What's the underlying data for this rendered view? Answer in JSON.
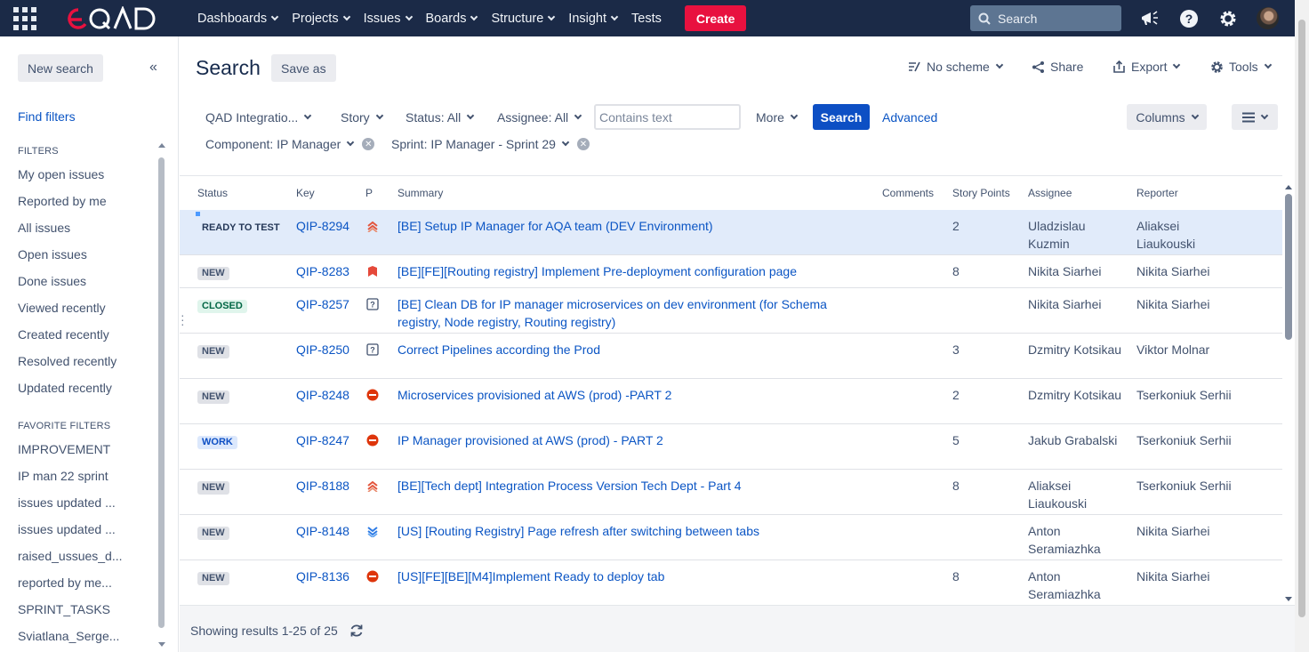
{
  "nav": {
    "items": [
      "Dashboards",
      "Projects",
      "Issues",
      "Boards",
      "Structure",
      "Insight"
    ],
    "tests": "Tests",
    "create": "Create",
    "search_placeholder": "Search"
  },
  "sidebar": {
    "new_search": "New search",
    "find_filters": "Find filters",
    "filters_heading": "FILTERS",
    "filters": [
      "My open issues",
      "Reported by me",
      "All issues",
      "Open issues",
      "Done issues",
      "Viewed recently",
      "Created recently",
      "Resolved recently",
      "Updated recently"
    ],
    "favorites_heading": "FAVORITE FILTERS",
    "favorites": [
      "IMPROVEMENT",
      "IP man 22 sprint",
      "issues updated ...",
      "issues updated ...",
      "raised_ussues_d...",
      "reported by me...",
      "SPRINT_TASKS",
      "Sviatlana_Serge..."
    ]
  },
  "header": {
    "title": "Search",
    "save_as": "Save as",
    "no_scheme": "No scheme",
    "share": "Share",
    "export": "Export",
    "tools": "Tools"
  },
  "filters": {
    "project": "QAD Integratio...",
    "type": "Story",
    "status": "Status: All",
    "assignee": "Assignee: All",
    "text_placeholder": "Contains text",
    "more": "More",
    "search": "Search",
    "advanced": "Advanced",
    "columns": "Columns",
    "component": "Component: IP Manager",
    "sprint": "Sprint: IP Manager - Sprint 29"
  },
  "table": {
    "columns": [
      "Status",
      "Key",
      "P",
      "Summary",
      "Comments",
      "Story Points",
      "Assignee",
      "Reporter"
    ],
    "rows": [
      {
        "status": "READY TO TEST",
        "status_style": "plain",
        "key": "QIP-8294",
        "priority": "highest",
        "summary": "[BE] Setup IP Manager for AQA team (DEV Environment)",
        "points": "2",
        "assignee": "Uladzislau Kuzmin",
        "reporter": "Aliaksei Liaukouski",
        "selected": true
      },
      {
        "status": "NEW",
        "status_style": "grey",
        "key": "QIP-8283",
        "priority": "critical",
        "summary": "[BE][FE][Routing registry] Implement Pre-deployment configuration page",
        "points": "8",
        "assignee": "Nikita Siarhei",
        "reporter": "Nikita Siarhei"
      },
      {
        "status": "CLOSED",
        "status_style": "green",
        "key": "QIP-8257",
        "priority": "undefined",
        "summary": "[BE] Clean DB for IP manager microservices on dev environment (for Schema registry, Node registry, Routing registry)",
        "points": "",
        "assignee": "Nikita Siarhei",
        "reporter": "Nikita Siarhei"
      },
      {
        "status": "NEW",
        "status_style": "grey",
        "key": "QIP-8250",
        "priority": "undefined",
        "summary": "Correct Pipelines according the Prod",
        "points": "3",
        "assignee": "Dzmitry Kotsikau",
        "reporter": "Viktor Molnar"
      },
      {
        "status": "NEW",
        "status_style": "grey",
        "key": "QIP-8248",
        "priority": "blocker",
        "summary": "Microservices provisioned at AWS (prod) -PART 2",
        "points": "2",
        "assignee": "Dzmitry Kotsikau",
        "reporter": "Tserkoniuk Serhii"
      },
      {
        "status": "WORK",
        "status_style": "blue",
        "key": "QIP-8247",
        "priority": "blocker",
        "summary": "IP Manager provisioned at AWS (prod) - PART 2",
        "points": "5",
        "assignee": "Jakub Grabalski",
        "reporter": "Tserkoniuk Serhii"
      },
      {
        "status": "NEW",
        "status_style": "grey",
        "key": "QIP-8188",
        "priority": "highest",
        "summary": "[BE][Tech dept] Integration Process Version Tech Dept - Part 4",
        "points": "8",
        "assignee": "Aliaksei Liaukouski",
        "reporter": "Tserkoniuk Serhii"
      },
      {
        "status": "NEW",
        "status_style": "grey",
        "key": "QIP-8148",
        "priority": "lowest",
        "summary": "[US] [Routing Registry] Page refresh after switching between tabs",
        "points": "",
        "assignee": "Anton Seramiazhka",
        "reporter": "Nikita Siarhei"
      },
      {
        "status": "NEW",
        "status_style": "grey",
        "key": "QIP-8136",
        "priority": "blocker",
        "summary": "[US][FE][BE][M4]Implement Ready to deploy tab",
        "points": "8",
        "assignee": "Anton Seramiazhka",
        "reporter": "Nikita Siarhei"
      }
    ]
  },
  "footer": {
    "results": "Showing results 1-25 of 25"
  },
  "colors": {
    "topbar": "#1b2a47",
    "create": "#e8113f",
    "primary": "#0d4fc4",
    "link": "#0b55c4"
  }
}
